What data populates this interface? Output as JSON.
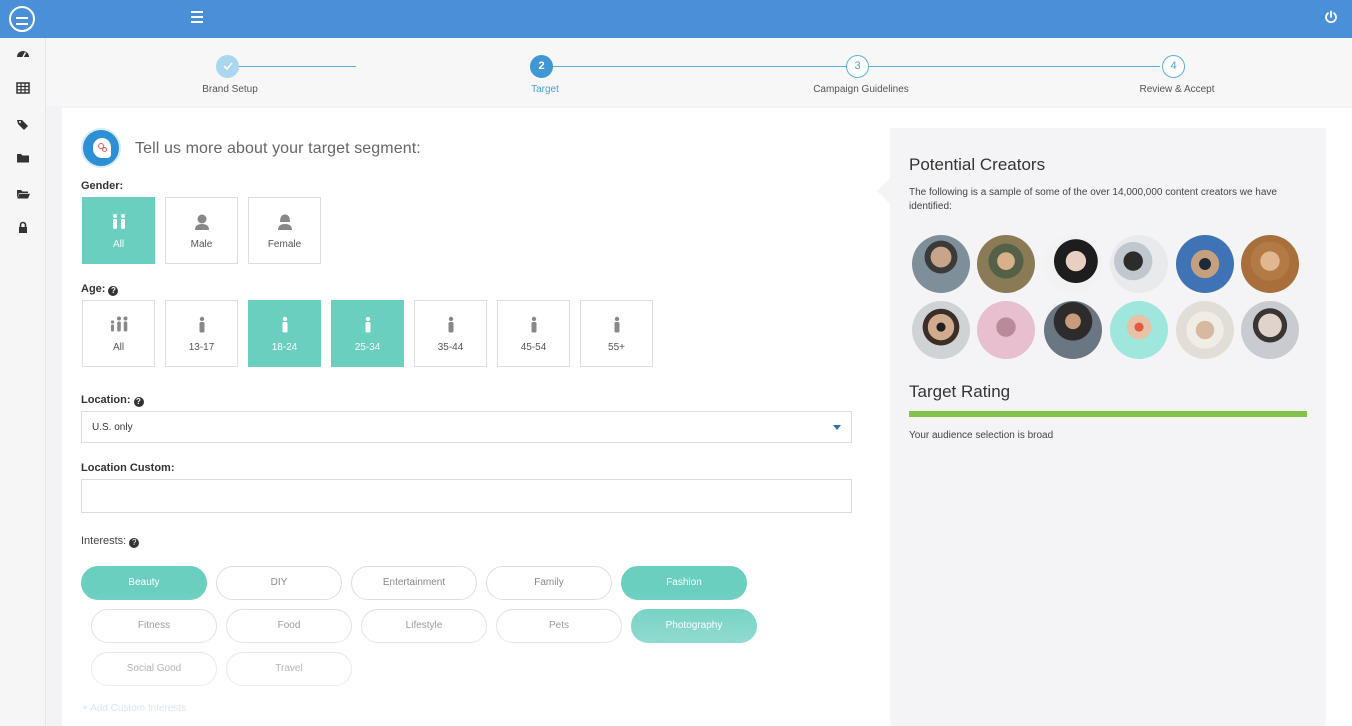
{
  "steps": [
    {
      "label": "Brand Setup",
      "number": "",
      "state": "done"
    },
    {
      "label": "Target",
      "number": "2",
      "state": "active"
    },
    {
      "label": "Campaign Guidelines",
      "number": "3",
      "state": "pending"
    },
    {
      "label": "Review & Accept",
      "number": "4",
      "state": "pending"
    }
  ],
  "form": {
    "heading": "Tell us more about your target segment:",
    "gender_label": "Gender:",
    "gender_options": [
      "All",
      "Male",
      "Female"
    ],
    "gender_selected": "All",
    "age_label": "Age:",
    "age_options": [
      "All",
      "13-17",
      "18-24",
      "25-34",
      "35-44",
      "45-54",
      "55+"
    ],
    "age_selected": [
      "18-24",
      "25-34"
    ],
    "location_label": "Location:",
    "location_value": "U.S. only",
    "location_custom_label": "Location Custom:",
    "location_custom_value": "",
    "interests_label": "Interests:",
    "interests": [
      "Beauty",
      "DIY",
      "Entertainment",
      "Family",
      "Fashion",
      "Fitness",
      "Food",
      "Lifestyle",
      "Pets",
      "Photography",
      "Social Good",
      "Travel"
    ],
    "interests_selected": [
      "Beauty",
      "Fashion",
      "Photography"
    ],
    "add_custom": "+ Add Custom Interests"
  },
  "panel": {
    "title": "Potential Creators",
    "description": "The following is a sample of some of the over 14,000,000 content creators we have identified:",
    "rating_title": "Target Rating",
    "rating_level": 1.0,
    "rating_text": "Your audience selection is broad"
  },
  "colors": {
    "topbar": "#4a90d9",
    "selected": "#6acfbf",
    "step_active": "#3f97d6",
    "rating": "#83c24a"
  },
  "icons": {
    "sidebar": [
      "dashboard-icon",
      "table-icon",
      "tags-icon",
      "folder-icon",
      "folder-open-icon",
      "lock-icon"
    ],
    "topbar": [
      "logo",
      "hamburger-menu-icon",
      "power-icon"
    ]
  }
}
